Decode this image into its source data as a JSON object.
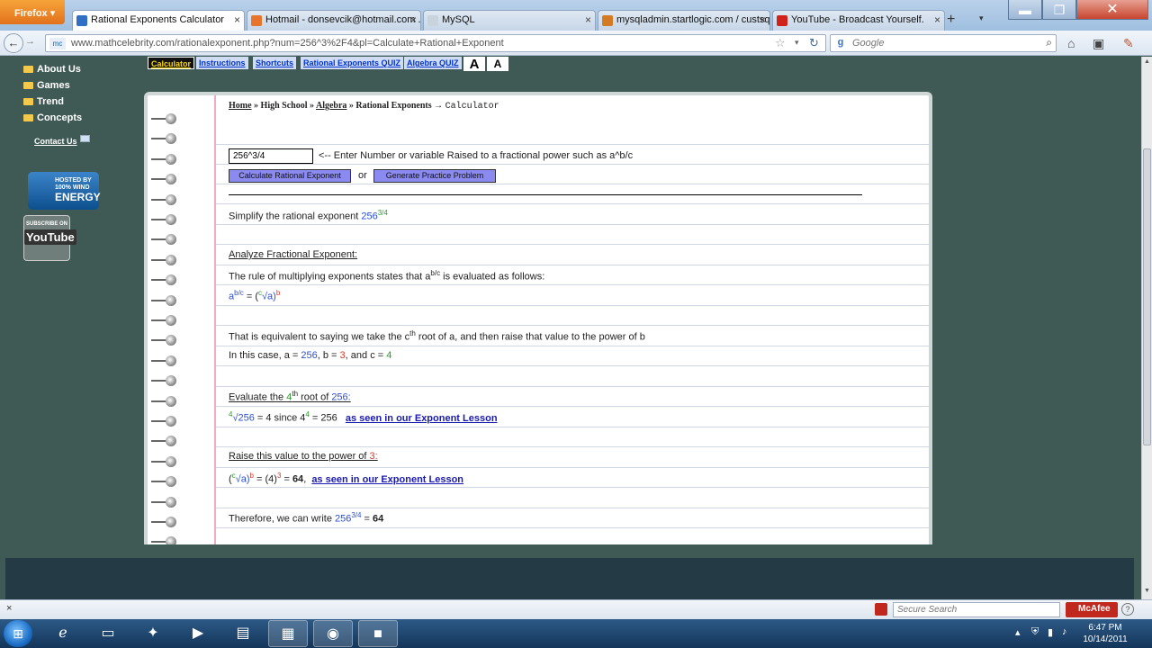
{
  "browser": {
    "app_button": "Firefox",
    "tabs": [
      {
        "label": "Rational Exponents Calculator",
        "active": true,
        "color": "#2f6fc4"
      },
      {
        "label": "Hotmail - donsevcik@hotmail.com ...",
        "active": false,
        "color": "#e8732a"
      },
      {
        "label": "MySQL",
        "active": false,
        "color": "#c9d3de"
      },
      {
        "label": "mysqladmin.startlogic.com / custsq...",
        "active": false,
        "color": "#d47a22"
      },
      {
        "label": "YouTube - Broadcast Yourself.",
        "active": false,
        "color": "#d0221b"
      }
    ],
    "url": "www.mathcelebrity.com/rationalexponent.php?num=256^3%2F4&pl=Calculate+Rational+Exponent",
    "site_badge": "mc",
    "search_placeholder": "Google",
    "search_engine_letter": "g"
  },
  "sidebar": {
    "items": [
      "About Us",
      "Games",
      "Trend",
      "Concepts"
    ],
    "contact": "Contact Us",
    "wind_badge": {
      "line1": "HOSTED BY",
      "line2": "100% WIND",
      "line3": "ENERGY"
    },
    "youtube_badge": {
      "line1": "SUBSCRIBE ON",
      "line2": "YouTube"
    }
  },
  "topnav": {
    "items": [
      "Calculator",
      "Instructions",
      "Shortcuts",
      "Rational Exponents QUIZ",
      "Algebra QUIZ"
    ],
    "font_large": "A",
    "font_small": "A"
  },
  "breadcrumb": {
    "home": "Home",
    "sep": "»",
    "high_school": "High School",
    "algebra": "Algebra",
    "rational": "Rational Exponents",
    "arrow": "→",
    "calculator": "Calculator"
  },
  "form": {
    "input_value": "256^3/4",
    "hint": "<-- Enter Number or variable Raised to a fractional power such as a^b/c",
    "calc_button": "Calculate Rational Exponent",
    "or": "or",
    "practice_button": "Generate Practice Problem"
  },
  "solution": {
    "simplify_prefix": "Simplify the rational exponent ",
    "base": "256",
    "exponent": "3/4",
    "analyze_heading": "Analyze Fractional Exponent:",
    "rule_text_prefix": "The rule of multiplying exponents states that a",
    "rule_exp": "b/c",
    "rule_text_suffix": " is evaluated as follows:",
    "formula_a": "a",
    "formula_exp": "b/c",
    "formula_eq": " = (",
    "formula_c": "c",
    "formula_root": "√a)",
    "formula_b": "b",
    "equiv_prefix": "That is equivalent to saying we take the c",
    "equiv_sup": "th",
    "equiv_suffix": " root of a, and then raise that value to the power of b",
    "case_prefix": "In this case, a = ",
    "a_val": "256",
    "b_label": ", b = ",
    "b_val": "3",
    "c_label": ", and c = ",
    "c_val": "4",
    "eval_prefix": "Evaluate the ",
    "eval_n": "4",
    "eval_sup": "th",
    "eval_mid": " root of ",
    "eval_base": "256:",
    "root_index": "4",
    "root_base": "√256",
    "root_result": " = 4 since 4",
    "root_power": "4",
    "root_eq": " = 256",
    "lesson_link": "as seen in our Exponent Lesson",
    "raise_prefix": "Raise this value to the power of ",
    "raise_val": "3:",
    "final_c": "c",
    "final_root": "√a)",
    "final_b": "b",
    "final_mid": " = (4)",
    "final_pow": "3",
    "final_eq": " = ",
    "final_result": "64",
    "final_comma": ",",
    "therefore_prefix": "Therefore, we can write ",
    "therefore_base": "256",
    "therefore_exp": "3/4",
    "therefore_eq": " = ",
    "therefore_result": "64"
  },
  "addon_bar": {
    "close": "×",
    "secure_search_placeholder": "Secure Search",
    "mcafee": "McAfee",
    "help": "?"
  },
  "taskbar": {
    "time": "6:47 PM",
    "date": "10/14/2011"
  }
}
